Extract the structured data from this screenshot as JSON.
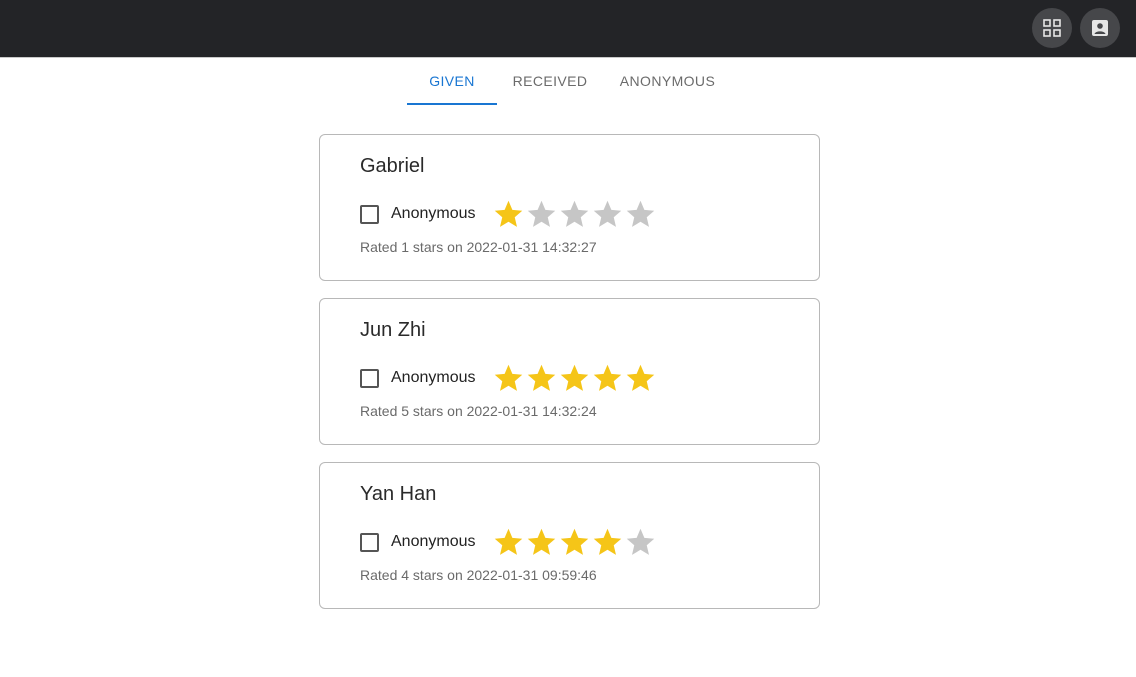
{
  "appbar": {
    "apps_icon": "grid-apps-icon",
    "account_icon": "account-box-icon"
  },
  "tabs": [
    {
      "label": "GIVEN",
      "active": true
    },
    {
      "label": "RECEIVED",
      "active": false
    },
    {
      "label": "ANONYMOUS",
      "active": false
    }
  ],
  "colors": {
    "accent": "#1976d2",
    "star_filled": "#f5c518",
    "star_empty": "#c6c6c6",
    "appbar": "#232427"
  },
  "ratings": [
    {
      "name": "Gabriel",
      "anonymous_label": "Anonymous",
      "anonymous_checked": false,
      "stars": 1,
      "max_stars": 5,
      "meta": "Rated 1 stars on 2022-01-31 14:32:27"
    },
    {
      "name": "Jun Zhi",
      "anonymous_label": "Anonymous",
      "anonymous_checked": false,
      "stars": 5,
      "max_stars": 5,
      "meta": "Rated 5 stars on 2022-01-31 14:32:24"
    },
    {
      "name": "Yan Han",
      "anonymous_label": "Anonymous",
      "anonymous_checked": false,
      "stars": 4,
      "max_stars": 5,
      "meta": "Rated 4 stars on 2022-01-31 09:59:46"
    }
  ]
}
